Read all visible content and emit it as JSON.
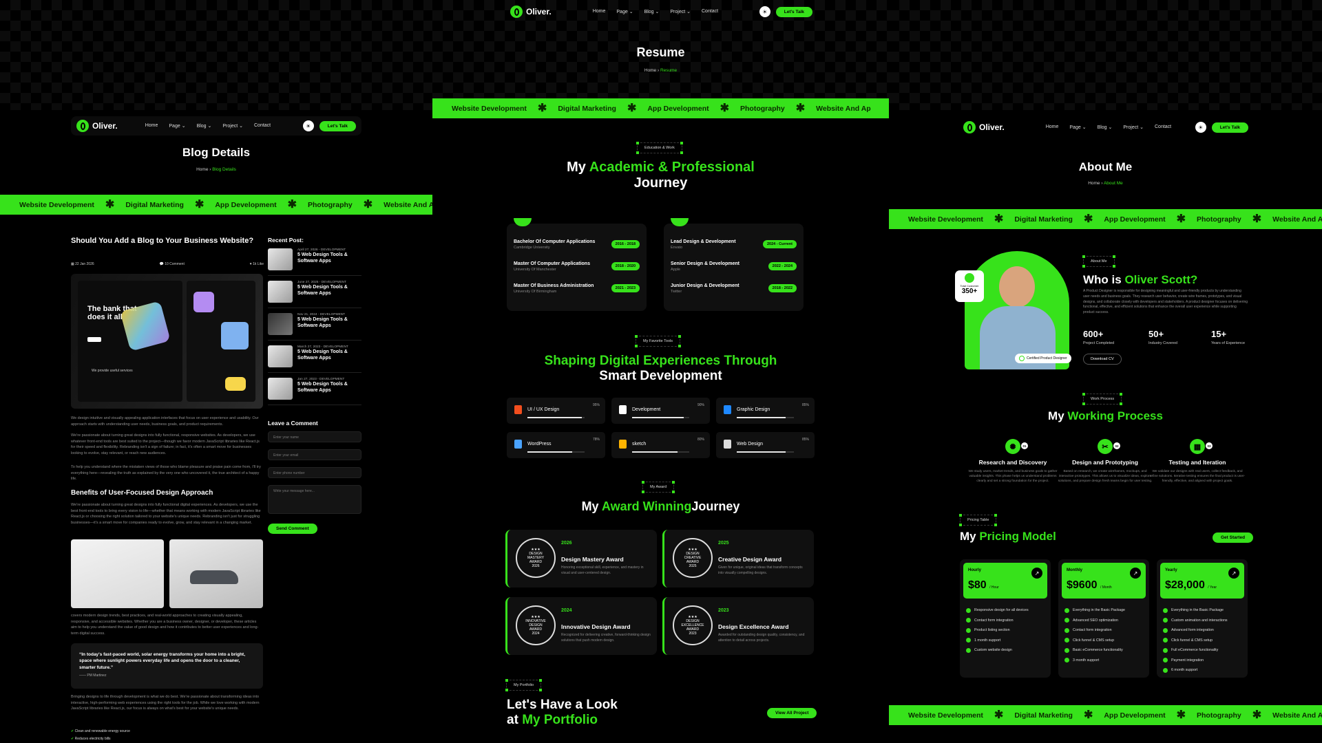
{
  "brand": "Oliver.",
  "nav": {
    "items": [
      "Home",
      "Page",
      "Blog",
      "Project",
      "Contact"
    ],
    "cta": "Let's Talk"
  },
  "ticker": [
    "Website Development",
    "Digital Marketing",
    "App Development",
    "Photography",
    "Website And Ap"
  ],
  "blog": {
    "title": "Blog Details",
    "crumb_home": "Home",
    "crumb_current": "Blog Details",
    "post_title": "Should You Add a Blog to Your Business Website?",
    "date": "22 Jan 2026",
    "comments": "10 Comment",
    "likes": "1k Like",
    "hero_text": "The bank that does it all",
    "hero_services": "We provide useful services",
    "para1": "We design intuitive and visually appealing application interfaces that focus on user experience and usability. Our approach starts with understanding user needs, business goals, and product requirements.",
    "para2": "We're passionate about turning great designs into fully functional, responsive websites. As developers, we use whatever front-end tools are best suited to the project—though we favor modern JavaScript libraries like React.js for their speed and flexibility. Rebranding isn't a sign of failure; in fact, it's often a smart move for businesses looking to evolve, stay relevant, or reach new audiences.",
    "para3": "To help you understand where the mistaken views of those who blame pleasure and praise pain come from, I'll try everything here—revealing the truth as explained by the very one who uncovered it, the true architect of a happy life.",
    "benefits_title": "Benefits of User-Focused Design Approach",
    "para4": "We're passionate about turning great designs into fully functional digital experiences. As developers, we use the best front-end tools to bring every vision to life—whether that means working with modern JavaScript libraries like React.js or choosing the right solution tailored to your website's unique needs. Rebranding isn't just for struggling businesses—it's a smart move for companies ready to evolve, grow, and stay relevant in a changing market.",
    "para5": "covers modern design trends, best practices, and real-world approaches to creating visually appealing, responsive, and accessible websites. Whether you are a business owner, designer, or developer, these articles aim to help you understand the value of good design and how it contributes to better user experiences and long-term digital success.",
    "quote": "“In today's fast-paced world, solar energy transforms your home into a bright, space where sunlight powers everyday life and opens the door to a cleaner, smarter future.”",
    "quote_author": "PM Martinez",
    "para6": "Bringing designs to life through development is what we do best. We're passionate about transforming ideas into interactive, high-performing web experiences using the right tools for the job. While we love working with modern JavaScript libraries like React.js, our focus is always on what's best for your website's unique needs.",
    "checks": [
      "Clean and renewable energy source",
      "Reduces electricity bills"
    ],
    "recent_title": "Recent Post:",
    "recent": [
      {
        "date": "April 27, 2026 - DEVELOPMENT",
        "title": "5 Web Design Tools & Software Apps"
      },
      {
        "date": "June 27, 2025 - DEVELOPMENT",
        "title": "5 Web Design Tools & Software Apps"
      },
      {
        "date": "Nov 21, 2024 - DEVELOPMENT",
        "title": "5 Web Design Tools & Software Apps"
      },
      {
        "date": "March 27, 2023 - DEVELOPMENT",
        "title": "5 Web Design Tools & Software Apps"
      },
      {
        "date": "Jan 27, 2023 - DEVELOPMENT",
        "title": "5 Web Design Tools & Software Apps"
      }
    ],
    "comment_title": "Leave a Comment",
    "ph_name": "Enter your name",
    "ph_email": "Enter your email",
    "ph_phone": "Enter phone number",
    "ph_msg": "Write your message here...",
    "send": "Send Comment"
  },
  "resume": {
    "title": "Resume",
    "crumb_home": "Home",
    "crumb_current": "Resume",
    "tag1": "Education & Work",
    "h_a": "My ",
    "h_b": "Academic & Professional",
    "h_c": "Journey",
    "edu": [
      {
        "t": "Bachelor Of Computer Applications",
        "s": "Cambridge University",
        "y": "2016 - 2018"
      },
      {
        "t": "Master Of Computer Applications",
        "s": "University Of Manchester",
        "y": "2018 - 2020"
      },
      {
        "t": "Master Of Business Administration",
        "s": "University Of Birmingham",
        "y": "2021 - 2023"
      }
    ],
    "work": [
      {
        "t": "Lead Design & Development",
        "s": "Envato",
        "y": "2024 - Current"
      },
      {
        "t": "Senior Design & Development",
        "s": "Apple",
        "y": "2022 - 2024"
      },
      {
        "t": "Junior Design & Development",
        "s": "Twitter",
        "y": "2018 - 2022"
      }
    ],
    "tag2": "My Favorite Tools",
    "h2_a": "Shaping Digital Experiences Through",
    "h2_b": "Smart Development",
    "tools": [
      {
        "n": "UI / UX Design",
        "p": "95%",
        "v": 95,
        "c": "#f24e1e"
      },
      {
        "n": "Development",
        "p": "90%",
        "v": 90,
        "c": "#ffffff"
      },
      {
        "n": "Graphic Design",
        "p": "85%",
        "v": 85,
        "c": "#1e88ff"
      },
      {
        "n": "WordPress",
        "p": "78%",
        "v": 78,
        "c": "#4aa3ff"
      },
      {
        "n": "sketch",
        "p": "80%",
        "v": 80,
        "c": "#fdb300"
      },
      {
        "n": "Web Design",
        "p": "85%",
        "v": 85,
        "c": "#dddddd"
      }
    ],
    "tag3": "My Award",
    "h3_a": "My ",
    "h3_b": "Award Winning",
    "h3_c": "Journey",
    "awards": [
      {
        "y": "2026",
        "n": "Design Mastery Award",
        "d": "Honoring exceptional skill, experience, and mastery in visual and user-centered design.",
        "s1": "DESIGN",
        "s2": "MASTERY",
        "s3": "AWARD",
        "sy": "2026"
      },
      {
        "y": "2025",
        "n": "Creative Design Award",
        "d": "Given for unique, original ideas that transform concepts into visually compelling designs.",
        "s1": "DESIGN",
        "s2": "CREATIVE",
        "s3": "AWARD",
        "sy": "2025"
      },
      {
        "y": "2024",
        "n": "Innovative Design Award",
        "d": "Recognized for delivering creative, forward-thinking design solutions that push modern design.",
        "s1": "INNOVATIVE",
        "s2": "DESIGN",
        "s3": "AWARD",
        "sy": "2024"
      },
      {
        "y": "2023",
        "n": "Design Excellence Award",
        "d": "Awarded for outstanding design quality, consistency, and attention to detail across projects.",
        "s1": "DESIGN",
        "s2": "EXCELLENCE",
        "s3": "AWARD",
        "sy": "2023"
      }
    ],
    "tag4": "My Portfolio",
    "h4_a": "Let's Have a Look",
    "h4_b": "at ",
    "h4_c": "My Portfolio",
    "view_all": "View All Project"
  },
  "about": {
    "title": "About Me",
    "crumb_home": "Home",
    "crumb_current": "About Me",
    "customers_label": "Total Customer",
    "customers": "350+",
    "certified": "Certified Product Designer",
    "tag": "About Me",
    "h_a": "Who is ",
    "h_b": "Oliver Scott?",
    "desc": "A Product Designer is responsible for designing meaningful and user-friendly products by understanding user needs and business goals. They research user behavior, create wire frames, prototypes, and visual designs, and collaborate closely with developers and stakeholders. A product designer focuses on delivering functional, effective, and efficient solutions that enhance the overall user experience while supporting product success.",
    "stats": [
      {
        "n": "600+",
        "l": "Project Completed"
      },
      {
        "n": "50+",
        "l": "Industry Covered"
      },
      {
        "n": "15+",
        "l": "Years of Experience"
      }
    ],
    "download": "Download CV",
    "tag2": "Work Process",
    "h2_a": "My ",
    "h2_b": "Working Process",
    "process": [
      {
        "t": "Research and Discovery",
        "n": "01",
        "d": "We study users, market trends, and business goals to gather valuable insights. This phase helps us understand problems clearly and set a strong foundation for the project."
      },
      {
        "t": "Design and Prototyping",
        "n": "02",
        "d": "Based on research, we create wireframes, mockups, and interactive prototypes. This allows us to visualize ideas, explore solutions, and prepare design fresh teams begin for user testing."
      },
      {
        "t": "Testing and Iteration",
        "n": "03",
        "d": "We validate our designs with real users, collect feedback, and refine solutions. Iterative testing ensures the final product is user-friendly, effective, and aligned with project goals."
      }
    ],
    "tag3": "Pricing Table",
    "h3_a": "My ",
    "h3_b": "Pricing Model",
    "get_started": "Get Started",
    "plans": [
      {
        "lb": "Hourly",
        "amt": "$80",
        "per": "/ Hour",
        "f": [
          "Responsive design for all devices",
          "Contact form integration",
          "Product listing section",
          "1 month support",
          "Custom website design"
        ]
      },
      {
        "lb": "Monthly",
        "amt": "$9600",
        "per": "/ Month",
        "f": [
          "Everything in the Basic Package",
          "Advanced SEO optimization",
          "Contact form integration",
          "Click funnel & CMS setup",
          "Basic eCommerce functionality",
          "3 month support"
        ]
      },
      {
        "lb": "Yearly",
        "amt": "$28,000",
        "per": "/ Year",
        "f": [
          "Everything in the Basic Package",
          "Custom animation and interactions",
          "Advanced form integration",
          "Click funnel & CMS setup",
          "Full eCommerce functionality",
          "Payment integration",
          "6 month support"
        ]
      }
    ]
  }
}
